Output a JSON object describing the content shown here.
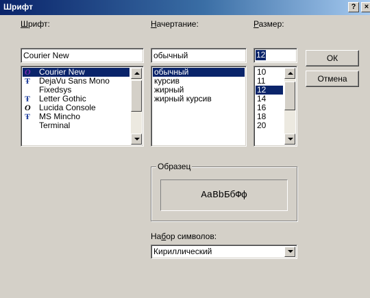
{
  "window": {
    "title": "Шрифт",
    "help_glyph": "?",
    "close_glyph": "×"
  },
  "font": {
    "label_key": "Ш",
    "label_rest": "рифт:",
    "value": "Courier New",
    "items": [
      {
        "name": "Courier New",
        "icon": "opentype-icon",
        "glyph": "O",
        "selected": true
      },
      {
        "name": "DejaVu Sans Mono",
        "icon": "truetype-icon",
        "glyph": "Ŧ"
      },
      {
        "name": "Fixedsys",
        "icon": "",
        "glyph": ""
      },
      {
        "name": "Letter Gothic",
        "icon": "truetype-icon",
        "glyph": "Ŧ"
      },
      {
        "name": "Lucida Console",
        "icon": "opentype-icon",
        "glyph": "O"
      },
      {
        "name": "MS Mincho",
        "icon": "truetype-icon",
        "glyph": "Ŧ"
      },
      {
        "name": "Terminal",
        "icon": "",
        "glyph": ""
      }
    ]
  },
  "style": {
    "label_key": "Н",
    "label_rest": "ачертание:",
    "value": "обычный",
    "items": [
      {
        "name": "обычный",
        "selected": true
      },
      {
        "name": "курсив"
      },
      {
        "name": "жирный"
      },
      {
        "name": "жирный курсив"
      }
    ]
  },
  "size": {
    "label_key": "Р",
    "label_rest": "азмер:",
    "value": "12",
    "items": [
      {
        "name": "10"
      },
      {
        "name": "11"
      },
      {
        "name": "12",
        "selected": true
      },
      {
        "name": "14"
      },
      {
        "name": "16"
      },
      {
        "name": "18"
      },
      {
        "name": "20"
      }
    ]
  },
  "buttons": {
    "ok": "ОК",
    "cancel": "Отмена"
  },
  "sample": {
    "title": "Образец",
    "text": "AaBbБбФф"
  },
  "charset": {
    "label_pre": "На",
    "label_key": "б",
    "label_rest": "ор символов:",
    "value": "Кириллический"
  }
}
